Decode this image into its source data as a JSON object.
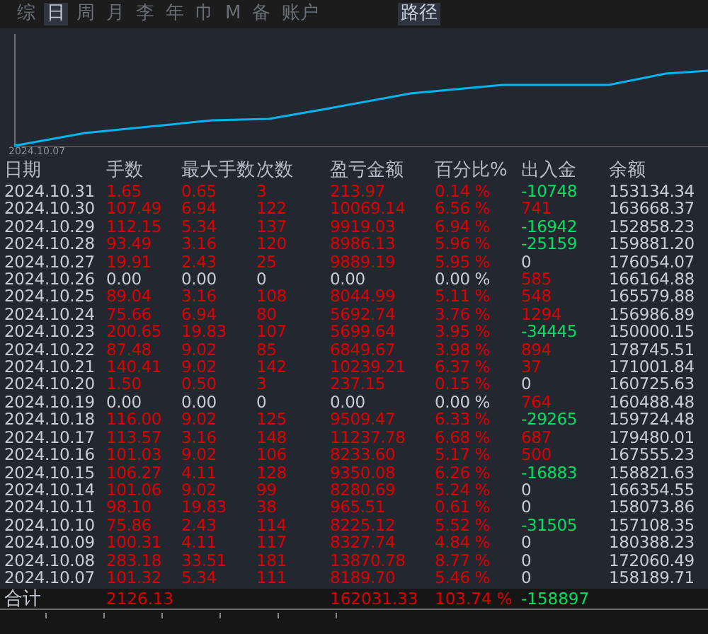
{
  "tabs": [
    {
      "label": "综",
      "selected": false
    },
    {
      "label": "日",
      "selected": true
    },
    {
      "label": "周",
      "selected": false
    },
    {
      "label": "月",
      "selected": false
    },
    {
      "label": "李",
      "selected": false
    },
    {
      "label": "年",
      "selected": false
    },
    {
      "label": "巾",
      "selected": false
    },
    {
      "label": "M",
      "selected": false
    },
    {
      "label": "备",
      "selected": false
    },
    {
      "label": "账户",
      "selected": false
    }
  ],
  "path_tab": {
    "label": "路径",
    "selected": true
  },
  "chart": {
    "start_label": "2024.10.07"
  },
  "table": {
    "columns": [
      "日期",
      "手数",
      "最大手数",
      "次数",
      "盈亏金额",
      "百分比%",
      "出入金",
      "余额"
    ],
    "rows": [
      {
        "date": "2024.10.31",
        "active": true,
        "lots": "1.65",
        "max_lots": "0.65",
        "count": "3",
        "pnl": "213.97",
        "pct": "0.14 %",
        "flow": {
          "text": "-10748",
          "color": "#00e060"
        },
        "balance": "153134.34"
      },
      {
        "date": "2024.10.30",
        "active": true,
        "lots": "107.49",
        "max_lots": "6.94",
        "count": "122",
        "pnl": "10069.14",
        "pct": "6.56 %",
        "flow": {
          "text": "741",
          "color": "#e00000"
        },
        "balance": "163668.37"
      },
      {
        "date": "2024.10.29",
        "active": true,
        "lots": "112.15",
        "max_lots": "5.34",
        "count": "137",
        "pnl": "9919.03",
        "pct": "6.94 %",
        "flow": {
          "text": "-16942",
          "color": "#00e060"
        },
        "balance": "152858.23"
      },
      {
        "date": "2024.10.28",
        "active": true,
        "lots": "93.49",
        "max_lots": "3.16",
        "count": "120",
        "pnl": "8986.13",
        "pct": "5.96 %",
        "flow": {
          "text": "-25159",
          "color": "#00e060"
        },
        "balance": "159881.20"
      },
      {
        "date": "2024.10.27",
        "active": true,
        "lots": "19.91",
        "max_lots": "2.43",
        "count": "25",
        "pnl": "9889.19",
        "pct": "5.95 %",
        "flow": {
          "text": "0",
          "color": "#c8ccd4"
        },
        "balance": "176054.07"
      },
      {
        "date": "2024.10.26",
        "active": false,
        "lots": "0.00",
        "max_lots": "0.00",
        "count": "0",
        "pnl": "0.00",
        "pct": "0.00 %",
        "flow": {
          "text": "585",
          "color": "#e00000"
        },
        "balance": "166164.88"
      },
      {
        "date": "2024.10.25",
        "active": true,
        "lots": "89.04",
        "max_lots": "3.16",
        "count": "108",
        "pnl": "8044.99",
        "pct": "5.11 %",
        "flow": {
          "text": "548",
          "color": "#e00000"
        },
        "balance": "165579.88"
      },
      {
        "date": "2024.10.24",
        "active": true,
        "lots": "75.66",
        "max_lots": "6.94",
        "count": "80",
        "pnl": "5692.74",
        "pct": "3.76 %",
        "flow": {
          "text": "1294",
          "color": "#e00000"
        },
        "balance": "156986.89"
      },
      {
        "date": "2024.10.23",
        "active": true,
        "lots": "200.65",
        "max_lots": "19.83",
        "count": "107",
        "pnl": "5699.64",
        "pct": "3.95 %",
        "flow": {
          "text": "-34445",
          "color": "#00e060"
        },
        "balance": "150000.15"
      },
      {
        "date": "2024.10.22",
        "active": true,
        "lots": "87.48",
        "max_lots": "9.02",
        "count": "85",
        "pnl": "6849.67",
        "pct": "3.98 %",
        "flow": {
          "text": "894",
          "color": "#e00000"
        },
        "balance": "178745.51"
      },
      {
        "date": "2024.10.21",
        "active": true,
        "lots": "140.41",
        "max_lots": "9.02",
        "count": "142",
        "pnl": "10239.21",
        "pct": "6.37 %",
        "flow": {
          "text": "37",
          "color": "#e00000"
        },
        "balance": "171001.84"
      },
      {
        "date": "2024.10.20",
        "active": true,
        "lots": "1.50",
        "max_lots": "0.50",
        "count": "3",
        "pnl": "237.15",
        "pct": "0.15 %",
        "flow": {
          "text": "0",
          "color": "#c8ccd4"
        },
        "balance": "160725.63"
      },
      {
        "date": "2024.10.19",
        "active": false,
        "lots": "0.00",
        "max_lots": "0.00",
        "count": "0",
        "pnl": "0.00",
        "pct": "0.00 %",
        "flow": {
          "text": "764",
          "color": "#e00000"
        },
        "balance": "160488.48"
      },
      {
        "date": "2024.10.18",
        "active": true,
        "lots": "116.00",
        "max_lots": "9.02",
        "count": "125",
        "pnl": "9509.47",
        "pct": "6.33 %",
        "flow": {
          "text": "-29265",
          "color": "#00e060"
        },
        "balance": "159724.48"
      },
      {
        "date": "2024.10.17",
        "active": true,
        "lots": "113.57",
        "max_lots": "3.16",
        "count": "148",
        "pnl": "11237.78",
        "pct": "6.68 %",
        "flow": {
          "text": "687",
          "color": "#e00000"
        },
        "balance": "179480.01"
      },
      {
        "date": "2024.10.16",
        "active": true,
        "lots": "101.03",
        "max_lots": "9.02",
        "count": "106",
        "pnl": "8233.60",
        "pct": "5.17 %",
        "flow": {
          "text": "500",
          "color": "#e00000"
        },
        "balance": "167555.23"
      },
      {
        "date": "2024.10.15",
        "active": true,
        "lots": "106.27",
        "max_lots": "4.11",
        "count": "128",
        "pnl": "9350.08",
        "pct": "6.26 %",
        "flow": {
          "text": "-16883",
          "color": "#00e060"
        },
        "balance": "158821.63"
      },
      {
        "date": "2024.10.14",
        "active": true,
        "lots": "101.06",
        "max_lots": "9.02",
        "count": "99",
        "pnl": "8280.69",
        "pct": "5.24 %",
        "flow": {
          "text": "0",
          "color": "#c8ccd4"
        },
        "balance": "166354.55"
      },
      {
        "date": "2024.10.11",
        "active": true,
        "lots": "98.10",
        "max_lots": "19.83",
        "count": "38",
        "pnl": "965.51",
        "pct": "0.61 %",
        "flow": {
          "text": "0",
          "color": "#c8ccd4"
        },
        "balance": "158073.86"
      },
      {
        "date": "2024.10.10",
        "active": true,
        "lots": "75.86",
        "max_lots": "2.43",
        "count": "114",
        "pnl": "8225.12",
        "pct": "5.52 %",
        "flow": {
          "text": "-31505",
          "color": "#00e060"
        },
        "balance": "157108.35"
      },
      {
        "date": "2024.10.09",
        "active": true,
        "lots": "100.31",
        "max_lots": "4.11",
        "count": "117",
        "pnl": "8327.74",
        "pct": "4.84 %",
        "flow": {
          "text": "0",
          "color": "#c8ccd4"
        },
        "balance": "180388.23"
      },
      {
        "date": "2024.10.08",
        "active": true,
        "lots": "283.18",
        "max_lots": "33.51",
        "count": "181",
        "pnl": "13870.78",
        "pct": "8.77 %",
        "flow": {
          "text": "0",
          "color": "#c8ccd4"
        },
        "balance": "172060.49"
      },
      {
        "date": "2024.10.07",
        "active": true,
        "lots": "101.32",
        "max_lots": "5.34",
        "count": "111",
        "pnl": "8189.70",
        "pct": "5.46 %",
        "flow": {
          "text": "0",
          "color": "#c8ccd4"
        },
        "balance": "158189.71"
      }
    ],
    "total": {
      "label": "合计",
      "lots": "2126.13",
      "pnl": "162031.33",
      "pct": "103.74 %",
      "flow": {
        "text": "-158897",
        "color": "#00e060"
      }
    }
  }
}
